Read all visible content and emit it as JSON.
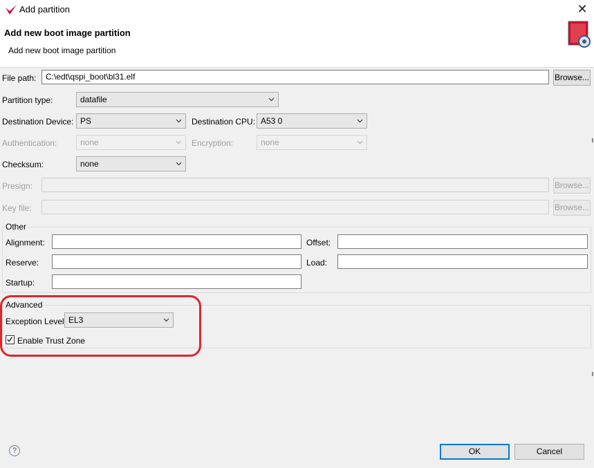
{
  "window": {
    "title": "Add partition",
    "close_glyph": "✕"
  },
  "header": {
    "title": "Add new boot image partition",
    "subtitle": "Add new boot image partition"
  },
  "file_path": {
    "label": "File path:",
    "value": "C:\\edt\\qspi_boot\\bl31.elf",
    "browse_label": "Browse..."
  },
  "partition_type": {
    "label": "Partition type:",
    "value": "datafile"
  },
  "destination_device": {
    "label": "Destination Device:",
    "value": "PS"
  },
  "destination_cpu": {
    "label": "Destination CPU:",
    "value": "A53 0"
  },
  "authentication": {
    "label": "Authentication:",
    "value": "none"
  },
  "encryption": {
    "label": "Encryption:",
    "value": "none"
  },
  "checksum": {
    "label": "Checksum:",
    "value": "none"
  },
  "presign": {
    "label": "Presign:",
    "value": "",
    "browse_label": "Browse..."
  },
  "key_file": {
    "label": "Key file:",
    "value": "",
    "browse_label": "Browse..."
  },
  "other": {
    "group_label": "Other",
    "alignment_label": "Alignment:",
    "alignment_value": "",
    "offset_label": "Offset:",
    "offset_value": "",
    "reserve_label": "Reserve:",
    "reserve_value": "",
    "load_label": "Load:",
    "load_value": "",
    "startup_label": "Startup:",
    "startup_value": ""
  },
  "advanced": {
    "group_label": "Advanced",
    "exception_level_label": "Exception Level",
    "exception_level_value": "EL3",
    "trust_zone_label": "Enable Trust Zone",
    "trust_zone_checked": true
  },
  "footer": {
    "help_glyph": "?",
    "ok_label": "OK",
    "cancel_label": "Cancel"
  },
  "colors": {
    "highlight": "#e0242b",
    "primary_border": "#0078d7",
    "logo_red": "#c8102e"
  },
  "icons": {
    "app": "xilinx-logo-icon",
    "wizard": "boot-image-wizard-icon",
    "help": "help-icon",
    "close": "close-icon",
    "dropdown": "chevron-down-icon"
  }
}
